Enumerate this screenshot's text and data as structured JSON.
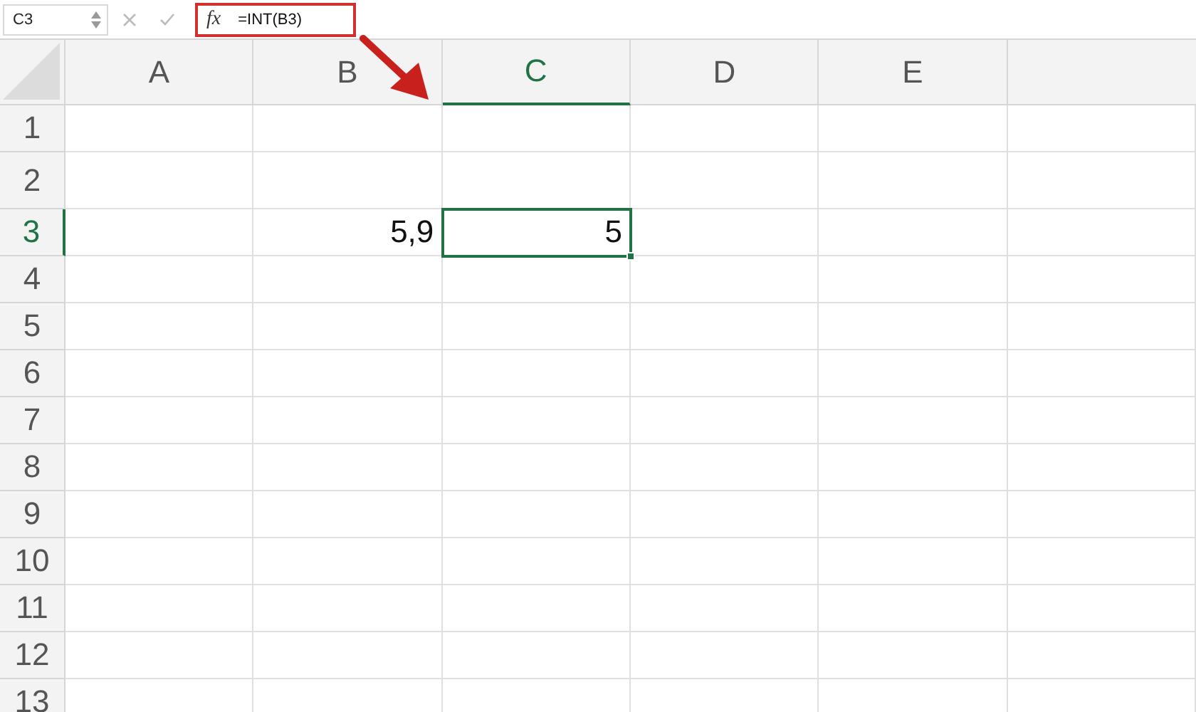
{
  "name_box": "C3",
  "formula_bar": {
    "fx": "fx",
    "formula": "=INT(B3)"
  },
  "annotations": {
    "formula_box": true,
    "arrow": true
  },
  "columns": [
    {
      "label": "A",
      "selected": false
    },
    {
      "label": "B",
      "selected": false
    },
    {
      "label": "C",
      "selected": true
    },
    {
      "label": "D",
      "selected": false
    },
    {
      "label": "E",
      "selected": false
    }
  ],
  "rows": [
    {
      "label": "1",
      "selected": false,
      "cells": [
        {
          "selected": false
        },
        {
          "selected": false
        },
        {
          "selected": false
        },
        {
          "selected": false
        },
        {
          "selected": false
        }
      ]
    },
    {
      "label": "2",
      "selected": false,
      "cells": [
        {
          "selected": false
        },
        {
          "selected": false
        },
        {
          "selected": false
        },
        {
          "selected": false
        },
        {
          "selected": false
        }
      ]
    },
    {
      "label": "3",
      "selected": true,
      "cells": [
        {
          "selected": false
        },
        {
          "text": "5,9",
          "selected": false
        },
        {
          "text": "5",
          "selected": true
        },
        {
          "selected": false
        },
        {
          "selected": false
        }
      ]
    },
    {
      "label": "4",
      "selected": false,
      "cells": [
        {
          "selected": false
        },
        {
          "selected": false
        },
        {
          "selected": false
        },
        {
          "selected": false
        },
        {
          "selected": false
        }
      ]
    },
    {
      "label": "5",
      "selected": false,
      "cells": [
        {
          "selected": false
        },
        {
          "selected": false
        },
        {
          "selected": false
        },
        {
          "selected": false
        },
        {
          "selected": false
        }
      ]
    },
    {
      "label": "6",
      "selected": false,
      "cells": [
        {
          "selected": false
        },
        {
          "selected": false
        },
        {
          "selected": false
        },
        {
          "selected": false
        },
        {
          "selected": false
        }
      ]
    },
    {
      "label": "7",
      "selected": false,
      "cells": [
        {
          "selected": false
        },
        {
          "selected": false
        },
        {
          "selected": false
        },
        {
          "selected": false
        },
        {
          "selected": false
        }
      ]
    },
    {
      "label": "8",
      "selected": false,
      "cells": [
        {
          "selected": false
        },
        {
          "selected": false
        },
        {
          "selected": false
        },
        {
          "selected": false
        },
        {
          "selected": false
        }
      ]
    },
    {
      "label": "9",
      "selected": false,
      "cells": [
        {
          "selected": false
        },
        {
          "selected": false
        },
        {
          "selected": false
        },
        {
          "selected": false
        },
        {
          "selected": false
        }
      ]
    },
    {
      "label": "10",
      "selected": false,
      "cells": [
        {
          "selected": false
        },
        {
          "selected": false
        },
        {
          "selected": false
        },
        {
          "selected": false
        },
        {
          "selected": false
        }
      ]
    },
    {
      "label": "11",
      "selected": false,
      "cells": [
        {
          "selected": false
        },
        {
          "selected": false
        },
        {
          "selected": false
        },
        {
          "selected": false
        },
        {
          "selected": false
        }
      ]
    },
    {
      "label": "12",
      "selected": false,
      "cells": [
        {
          "selected": false
        },
        {
          "selected": false
        },
        {
          "selected": false
        },
        {
          "selected": false
        },
        {
          "selected": false
        }
      ]
    },
    {
      "label": "13",
      "selected": false,
      "cells": [
        {
          "selected": false
        },
        {
          "selected": false
        },
        {
          "selected": false
        },
        {
          "selected": false
        },
        {
          "selected": false
        }
      ]
    }
  ]
}
